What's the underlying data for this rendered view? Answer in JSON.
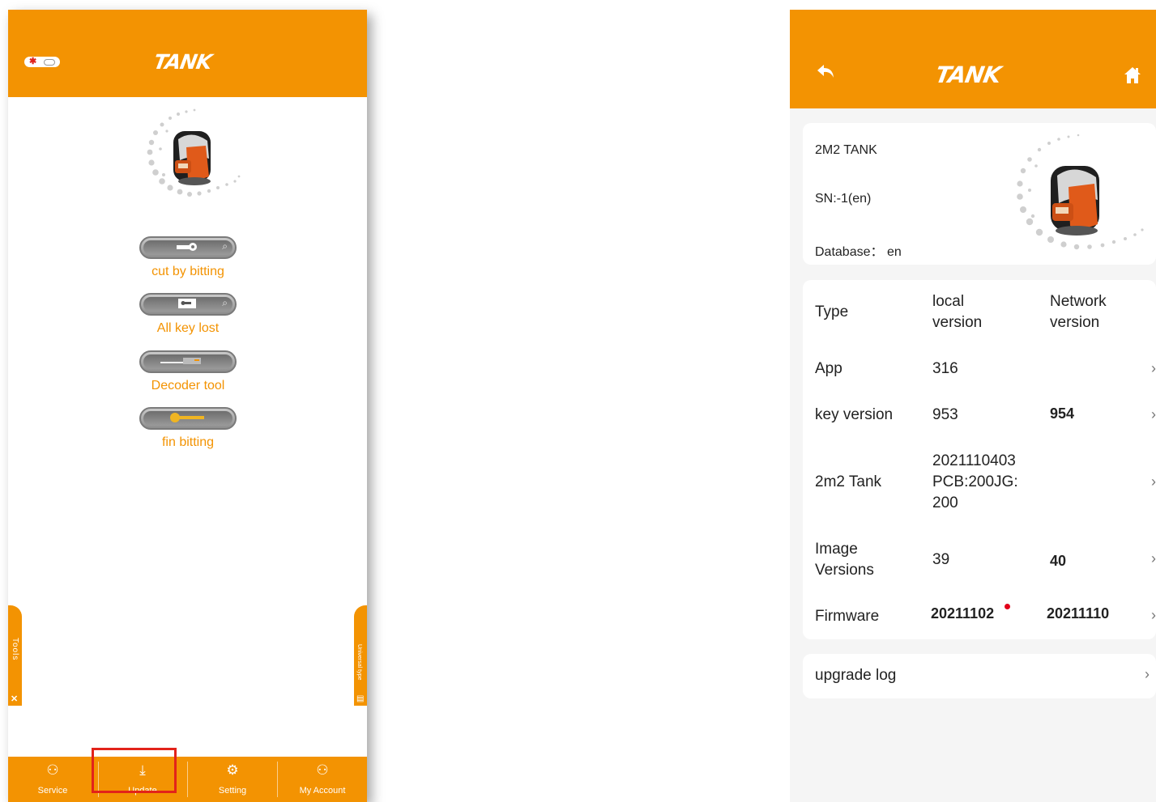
{
  "left": {
    "brand": "TANK",
    "status_badge": "Bluetooth connected",
    "functions": [
      {
        "label": "cut by bitting",
        "icon": "key-search-icon"
      },
      {
        "label": "All key lost",
        "icon": "folder-key-icon"
      },
      {
        "label": "Decoder tool",
        "icon": "decoder-icon"
      },
      {
        "label": "fin bitting",
        "icon": "gold-key-icon"
      }
    ],
    "side_tabs": {
      "left": "Tools",
      "right": "Universal type"
    },
    "nav": [
      {
        "label": "Service",
        "icon": "service-icon"
      },
      {
        "label": "Update",
        "icon": "download-icon"
      },
      {
        "label": "Setting",
        "icon": "gears-icon"
      },
      {
        "label": "My Account",
        "icon": "account-icon"
      }
    ],
    "highlighted_nav": "Update"
  },
  "right": {
    "brand": "TANK",
    "device": {
      "name": "2M2 TANK",
      "sn": "SN:-1(en)",
      "database": "Database： en"
    },
    "table": {
      "headers": {
        "type": "Type",
        "local": [
          "local",
          "version"
        ],
        "network": [
          "Network",
          "version"
        ]
      },
      "rows": [
        {
          "type": [
            "App"
          ],
          "local": [
            "316"
          ],
          "network": [
            ""
          ]
        },
        {
          "type": [
            "key version"
          ],
          "local": [
            "953"
          ],
          "network": [
            "954"
          ]
        },
        {
          "type": [
            "2m2 Tank"
          ],
          "local": [
            "2021110403",
            "PCB:200JG:",
            "200"
          ],
          "network": [
            ""
          ]
        },
        {
          "type": [
            "Image",
            "Versions"
          ],
          "local": [
            "39"
          ],
          "network": [
            "40"
          ]
        },
        {
          "type": [
            "Firmware"
          ],
          "local": [
            "20211102"
          ],
          "network": [
            "20211110"
          ]
        }
      ]
    },
    "upgrade_log": "upgrade log"
  },
  "colors": {
    "brand_orange": "#f39302",
    "highlight_red": "#e2231a",
    "update_dot": "#e2001a"
  }
}
